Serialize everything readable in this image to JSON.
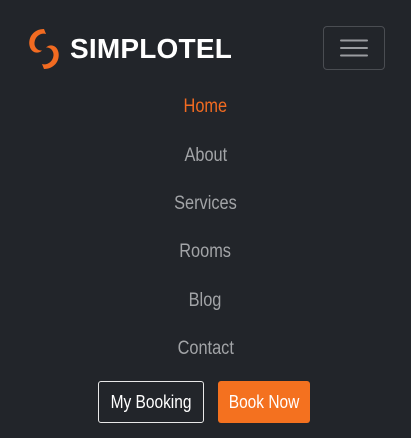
{
  "brand": {
    "name": "SIMPLOTEL",
    "logo_icon": "simplotel-swirl-logo",
    "logo_color": "#f26b21"
  },
  "toggler": {
    "icon": "hamburger-menu-icon"
  },
  "nav": {
    "items": [
      {
        "label": "Home",
        "active": true
      },
      {
        "label": "About",
        "active": false
      },
      {
        "label": "Services",
        "active": false
      },
      {
        "label": "Rooms",
        "active": false
      },
      {
        "label": "Blog",
        "active": false
      },
      {
        "label": "Contact",
        "active": false
      }
    ]
  },
  "actions": {
    "my_booking_label": "My Booking",
    "book_now_label": "Book Now"
  },
  "colors": {
    "background": "#22252a",
    "accent": "#f26b21",
    "nav_text": "#a2a4a7",
    "book_now_bg": "#f4711f"
  }
}
